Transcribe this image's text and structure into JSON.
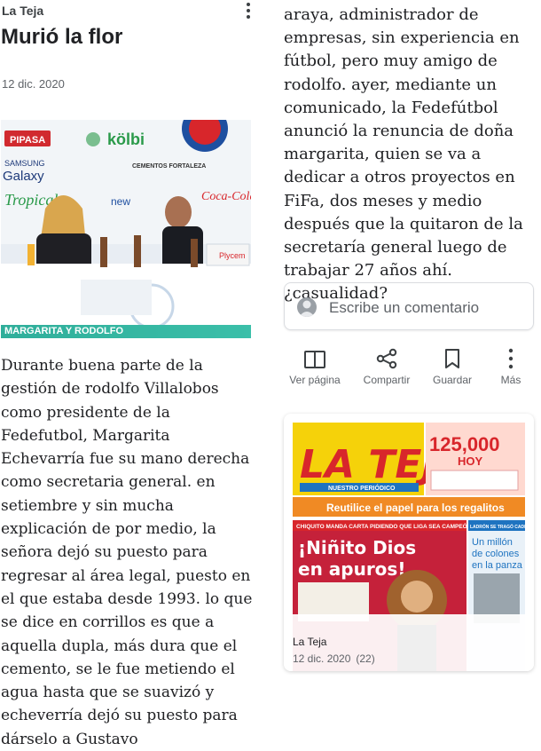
{
  "article": {
    "source": "La Teja",
    "title": "Murió la flor",
    "date": "12 dic. 2020",
    "photo_caption": "MARGARITA Y RODOLFO",
    "photo_text": {
      "sponsor_pipasa": "PIPASA",
      "sponsor_kolbi": "kölbi",
      "sponsor_samsung": "SAMSUNG",
      "sponsor_galaxy": "Galaxy",
      "sponsor_tropical": "Tropical",
      "sponsor_cementos": "CEMENTOS FORTALEZA",
      "sponsor_new": "new",
      "sponsor_cocacola": "Coca-Cola",
      "sponsor_plycem": "Plycem"
    },
    "paragraph_left": "Durante buena parte de la gestión de rodolfo Villalobos como presidente de la Fedefutbol, Margarita Echevarría fue su mano derecha como secretaria general. en setiembre y sin mucha explicación de por medio, la señora dejó su puesto para regresar al área legal, puesto en el que estaba desde 1993. lo que se dice en corrillos es que a aquella dupla, más dura que el cemento, se le fue metiendo el agua hasta que se suavizó y echeverría dejó su puesto para dárselo a Gustavo",
    "paragraph_right": "araya, administrador de empresas, sin experiencia en fútbol, pero muy amigo de rodolfo. ayer, mediante un comunicado, la Fedefútbol anunció la renuncia de doña margarita, quien se va a dedicar a otros proyectos en FiFa, dos meses y medio después que la quitaron de la secretaría general luego de trabajar 27 años ahí. ¿casualidad?"
  },
  "comment": {
    "placeholder": "Escribe un comentario"
  },
  "actions": {
    "view_page": "Ver página",
    "share": "Compartir",
    "save": "Guardar",
    "more": "Más"
  },
  "issue_card": {
    "source": "La Teja",
    "date": "12 dic. 2020",
    "count": "(22)",
    "cover": {
      "masthead": "LA TEJA",
      "tagline": "NUESTRO PERIÓDICO",
      "promo_amount": "125,000",
      "promo_word": "HOY",
      "banner": "Reutilice el papel para los regalitos",
      "kicker": "CHIQUITO MANDA CARTA PIDIENDO QUE LIGA SEA CAMPEÓN",
      "headline_line1": "¡Niñito Dios",
      "headline_line2": "en apuros!",
      "side_kicker": "LADRÓN SE TRAGÓ CADENA",
      "side_headline_1": "Un millón",
      "side_headline_2": "de colones",
      "side_headline_3": "en la panza"
    }
  },
  "colors": {
    "caption_bg": "#2fae9a",
    "text": "#202124",
    "secondary": "#5f6368",
    "cover_yellow": "#f5d20a",
    "cover_red": "#d8262b",
    "cover_blue": "#1e73c0"
  }
}
